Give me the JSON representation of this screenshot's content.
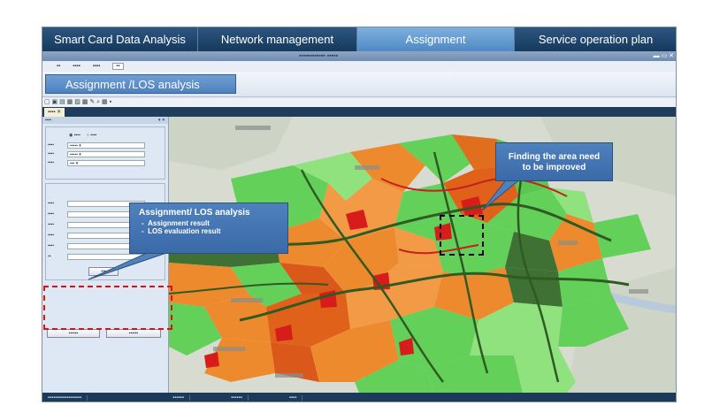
{
  "main_tabs": [
    {
      "label": "Smart Card Data Analysis",
      "active": false
    },
    {
      "label": "Network management",
      "active": false
    },
    {
      "label": "Assignment",
      "active": true
    },
    {
      "label": "Service operation plan",
      "active": false
    }
  ],
  "section_title": "Assignment /LOS analysis",
  "callouts": {
    "assignment": {
      "title": "Assignment/ LOS analysis",
      "items": [
        "Assignment result",
        "LOS evaluation result"
      ]
    },
    "finding": "Finding the area need to be improved"
  },
  "colors": {
    "tab_dark": "#1f4570",
    "tab_active": "#6a9fd3",
    "callout": "#4f81bd",
    "highlight_red": "#e01010",
    "map_green": "#63d05a",
    "map_orange": "#ee8a2e",
    "map_dark_green": "#3c6b2f"
  }
}
